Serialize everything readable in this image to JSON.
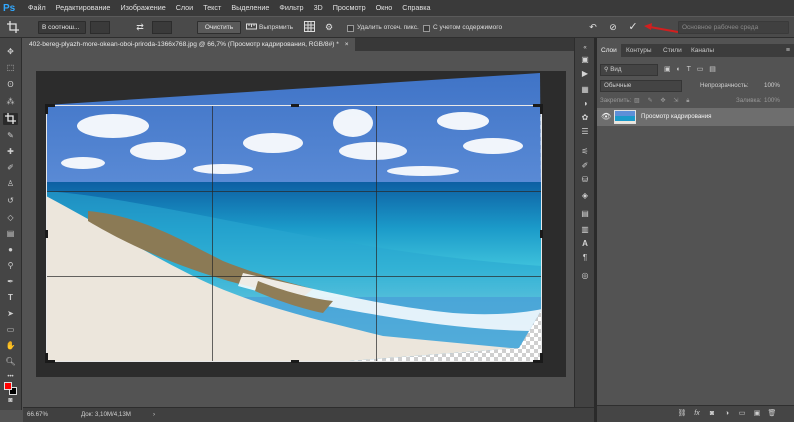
{
  "app": {
    "logo": "Ps"
  },
  "menu": [
    "Файл",
    "Редактирование",
    "Изображение",
    "Слои",
    "Текст",
    "Выделение",
    "Фильтр",
    "3D",
    "Просмотр",
    "Окно",
    "Справка"
  ],
  "options_bar": {
    "ratio_select": "В соотнош...",
    "clear_button": "Очистить",
    "straighten_label": "Выпрямить",
    "delete_cropped_label": "Удалить отсеч. пикс.",
    "content_aware_label": "С учетом содержимого",
    "workspace_placeholder": "Основное рабочее среда"
  },
  "document": {
    "tab_title": "402-bereg-plyazh-more-okean-oboi-priroda-1366x768.jpg @ 66,7% (Просмотр кадрирования, RGB/8#) *",
    "tab_close": "×"
  },
  "status": {
    "zoom": "66.67%",
    "doc_size": "Док: 3,10M/4,13M",
    "arrow": "›"
  },
  "layers_panel": {
    "tabs": [
      "Слои",
      "Контуры",
      "Стили",
      "Каналы"
    ],
    "filter_label": "Вид",
    "blend_mode": "Обычные",
    "opacity_label": "Непрозрачность:",
    "opacity_value": "100%",
    "lock_label": "Закрепить:",
    "fill_label": "Заливка:",
    "fill_value": "100%",
    "layer_name": "Просмотр кадрирования"
  },
  "colors": {
    "foreground": "#ff0000",
    "background": "#000000",
    "accent_arrow": "#d11f1f"
  },
  "icons": {
    "crop_tool": "crop-icon",
    "swap": "swap-icon",
    "grid": "grid-overlay-icon",
    "settings": "gear-icon",
    "reset": "reset-icon",
    "cancel": "cancel-icon",
    "commit": "checkmark-icon"
  }
}
